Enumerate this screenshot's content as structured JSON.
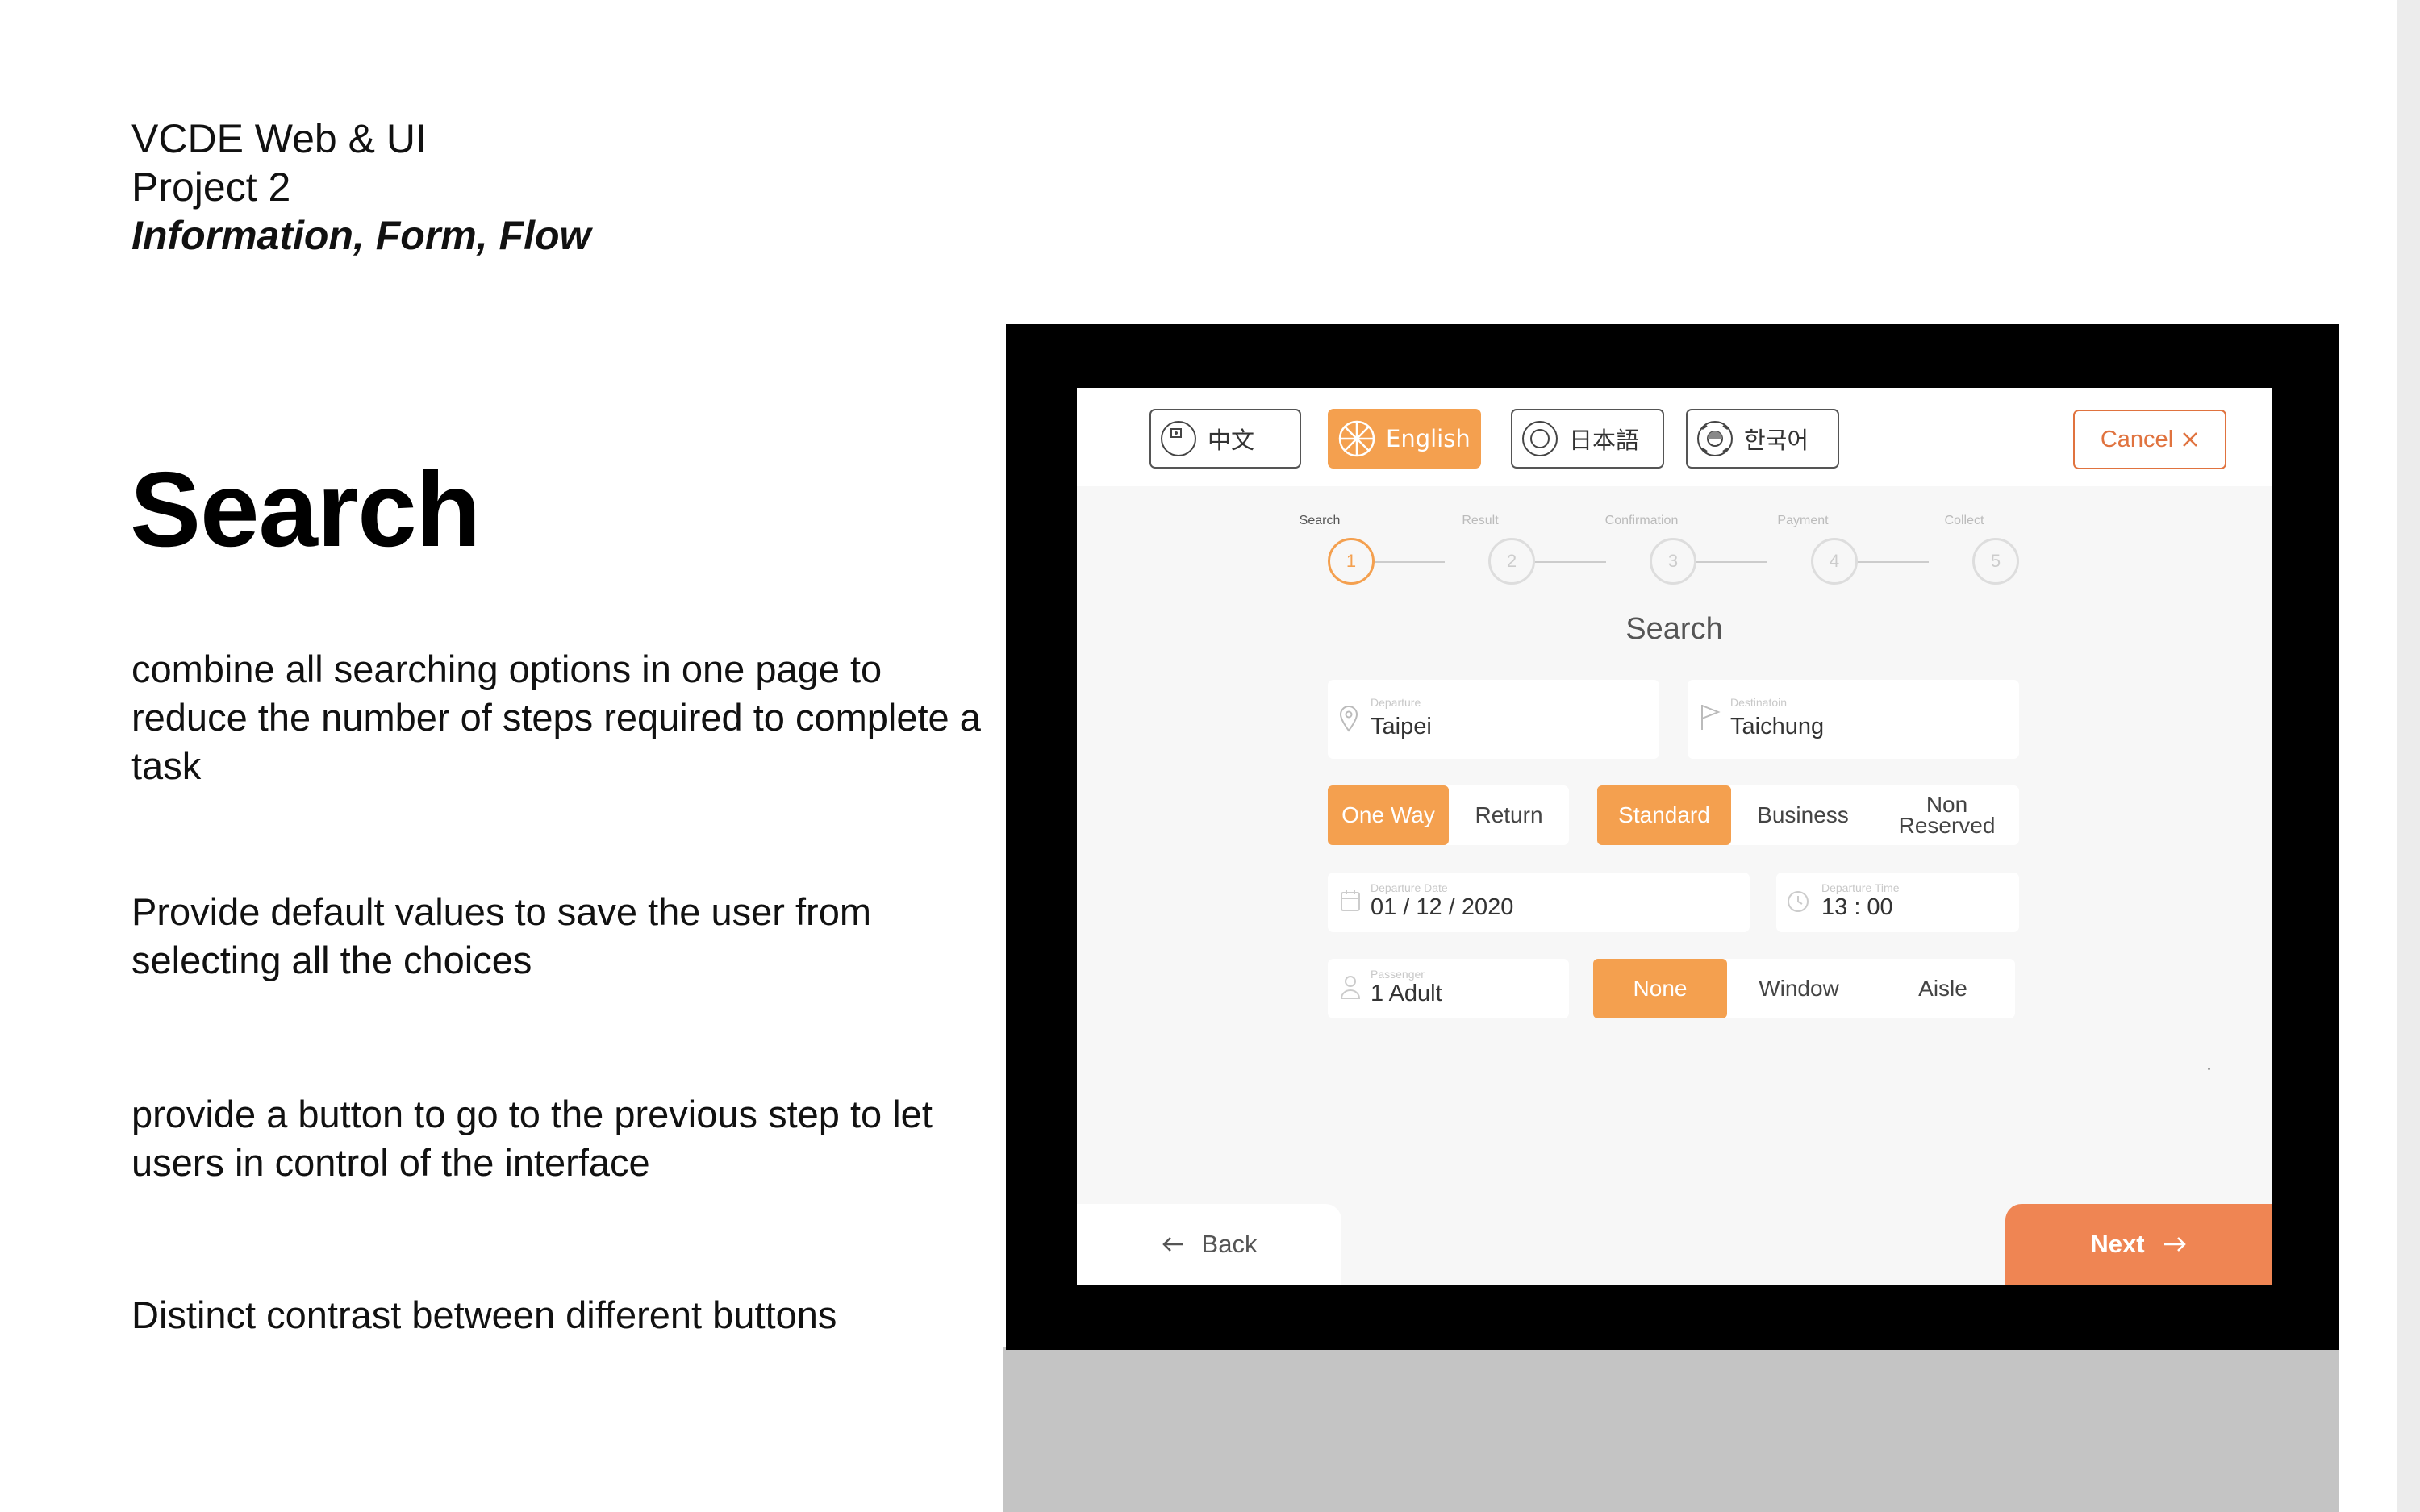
{
  "slide": {
    "course_line1": "VCDE Web & UI",
    "course_line2": "Project 2",
    "course_line3": "Information, Form, Flow",
    "heading": "Search",
    "notes": [
      "combine  all searching options in one page to reduce the number of steps required to complete a task",
      "Provide default values to save the user from selecting all the choices",
      "provide a button to go to the previous step to let users in control of the interface",
      "Distinct contrast between different buttons"
    ]
  },
  "app": {
    "languages": [
      {
        "label": "中文",
        "icon": "globe-asia-icon",
        "active": false
      },
      {
        "label": "English",
        "icon": "globe-icon",
        "active": true
      },
      {
        "label": "日本語",
        "icon": "japan-flag-icon",
        "active": false
      },
      {
        "label": "한국어",
        "icon": "korea-flag-icon",
        "active": false
      }
    ],
    "cancel_label": "Cancel",
    "steps": [
      {
        "label": "Search",
        "number": "1",
        "active": true
      },
      {
        "label": "Result",
        "number": "2",
        "active": false
      },
      {
        "label": "Confirmation",
        "number": "3",
        "active": false
      },
      {
        "label": "Payment",
        "number": "4",
        "active": false
      },
      {
        "label": "Collect",
        "number": "5",
        "active": false
      }
    ],
    "page_title": "Search",
    "departure": {
      "label": "Departure",
      "value": "Taipei",
      "icon": "location-pin-icon"
    },
    "destination": {
      "label": "Destinatoin",
      "value": "Taichung",
      "icon": "flag-icon"
    },
    "trip_type": {
      "options": [
        "One Way",
        "Return"
      ],
      "selected": "One Way"
    },
    "car_class": {
      "options": [
        "Standard",
        "Business",
        "Non Reserved"
      ],
      "selected": "Standard"
    },
    "departure_date": {
      "label": "Departure Date",
      "value": "01 / 12 / 2020",
      "icon": "calendar-icon"
    },
    "departure_time": {
      "label": "Departure Time",
      "value": "13 : 00",
      "icon": "clock-icon"
    },
    "passenger": {
      "label": "Passenger",
      "value": "1 Adult",
      "icon": "person-icon"
    },
    "seat": {
      "options": [
        "None",
        "Window",
        "Aisle"
      ],
      "selected": "None"
    },
    "back_label": "Back",
    "next_label": "Next",
    "colors": {
      "accent": "#f4a04f",
      "next": "#ef8553",
      "cancel": "#e0733f"
    }
  }
}
